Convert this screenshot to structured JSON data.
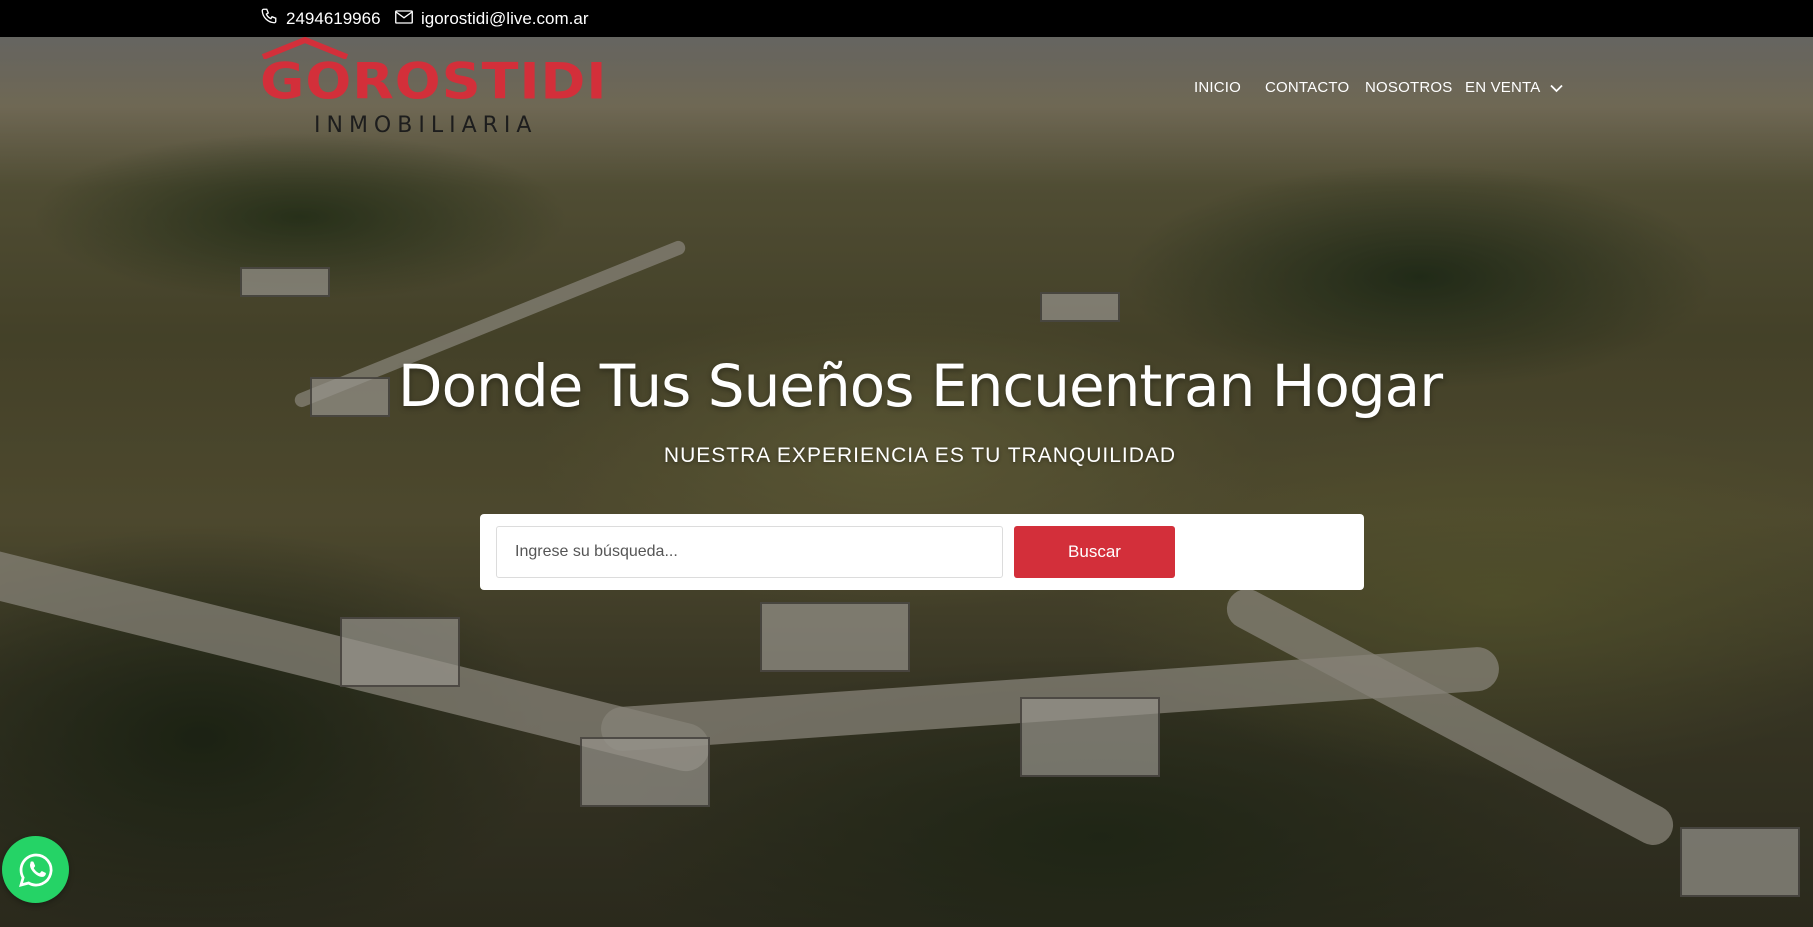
{
  "topbar": {
    "phone": "2494619966",
    "email": "igorostidi@live.com.ar",
    "phone_icon": "phone-icon",
    "email_icon": "envelope-icon"
  },
  "brand": {
    "name": "GOROSTIDI",
    "subtitle": "INMOBILIARIA",
    "color": "#d32f3a"
  },
  "nav": {
    "items": [
      {
        "label": "INICIO"
      },
      {
        "label": "CONTACTO"
      },
      {
        "label": "NOSOTROS"
      },
      {
        "label": "EN VENTA",
        "has_dropdown": true
      }
    ]
  },
  "hero": {
    "headline": "Donde Tus Sueños Encuentran Hogar",
    "subheadline": "NUESTRA EXPERIENCIA ES TU TRANQUILIDAD"
  },
  "search": {
    "placeholder": "Ingrese su búsqueda...",
    "value": "",
    "button_label": "Buscar"
  },
  "whatsapp": {
    "icon": "whatsapp-icon",
    "color": "#25d366"
  }
}
